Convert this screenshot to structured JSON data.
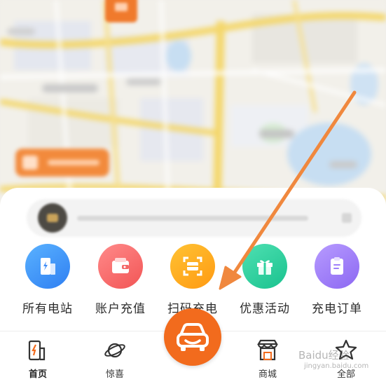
{
  "shortcuts": [
    {
      "label": "所有电站",
      "icon": "station-icon",
      "color": "#3f93fb"
    },
    {
      "label": "账户充值",
      "icon": "wallet-icon",
      "color": "#f46868"
    },
    {
      "label": "扫码充电",
      "icon": "scan-icon",
      "color": "#ffac1c"
    },
    {
      "label": "优惠活动",
      "icon": "gift-icon",
      "color": "#2fd19e"
    },
    {
      "label": "充电订单",
      "icon": "order-icon",
      "color": "#9f80fa"
    }
  ],
  "tabs": [
    {
      "label": "首页",
      "icon": "home-station-icon",
      "active": true
    },
    {
      "label": "惊喜",
      "icon": "planet-icon",
      "active": false
    },
    {
      "label": "",
      "icon": "car-icon",
      "active": false
    },
    {
      "label": "商城",
      "icon": "shop-icon",
      "active": false
    },
    {
      "label": "全部",
      "icon": "star-icon",
      "active": false
    }
  ],
  "accent_color": "#f26b1d",
  "watermark": {
    "text": "Baidu经验",
    "sub": "jingyan.baidu.com"
  }
}
